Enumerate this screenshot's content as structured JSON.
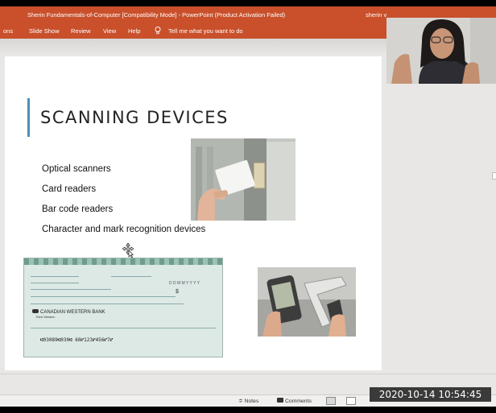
{
  "window": {
    "title": "Sherin Fundamentals-of-Computer [Compatibility Mode]  -  PowerPoint (Product Activation Failed)",
    "user": "sherin v"
  },
  "ribbon": {
    "tabs": [
      "ons",
      "Slide Show",
      "Review",
      "View",
      "Help"
    ],
    "tell_me": "Tell me what you want to do"
  },
  "slide": {
    "title": "SCANNING DEVICES",
    "bullets": [
      "Optical scanners",
      "Card readers",
      "Bar code readers",
      "Character and mark recognition devices"
    ],
    "cheque": {
      "bank": "CANADIAN WESTERN BANK",
      "tagline": "Think Western",
      "micr": "⑆03089⑆030⑆  60⑈123⑈456⑈7⑈"
    }
  },
  "statusbar": {
    "notes": "Notes",
    "comments": "Comments"
  },
  "timestamp": "2020-10-14  10:54:45",
  "colors": {
    "ribbon": "#c9502b",
    "title_accent": "#4d8fb8",
    "slide_bg": "#ffffff",
    "app_bg": "#e9e7e5"
  }
}
